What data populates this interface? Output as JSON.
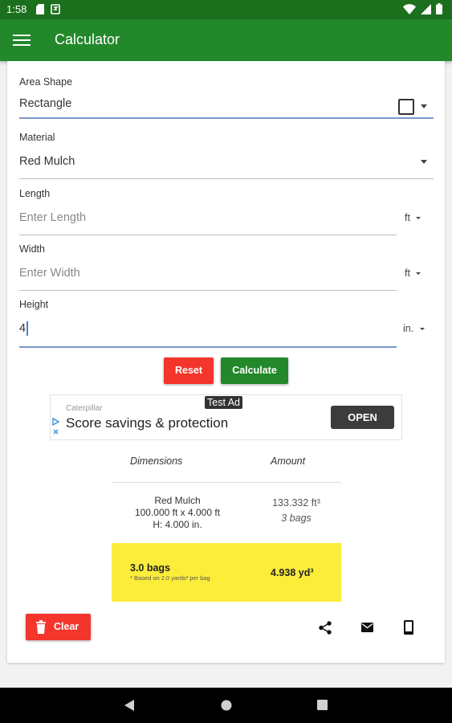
{
  "status_bar": {
    "time": "1:58"
  },
  "app_bar": {
    "title": "Calculator"
  },
  "form": {
    "area_shape": {
      "label": "Area Shape",
      "value": "Rectangle"
    },
    "material": {
      "label": "Material",
      "value": "Red Mulch"
    },
    "length": {
      "label": "Length",
      "placeholder": "Enter Length",
      "unit": "ft"
    },
    "width": {
      "label": "Width",
      "placeholder": "Enter Width",
      "unit": "ft"
    },
    "height": {
      "label": "Height",
      "value": "4",
      "unit": "in."
    }
  },
  "buttons": {
    "reset": "Reset",
    "calculate": "Calculate",
    "clear": "Clear"
  },
  "ad": {
    "tag": "Test Ad",
    "brand": "Caterpillar",
    "title": "Score savings & protection",
    "cta": "OPEN"
  },
  "results": {
    "headers": {
      "dimensions": "Dimensions",
      "amount": "Amount"
    },
    "row": {
      "material": "Red Mulch",
      "dims": "100.000 ft x 4.000 ft",
      "height": "H: 4.000 in.",
      "volume": "133.332 ft³",
      "bags": "3 bags"
    },
    "summary": {
      "bags": "3.0 bags",
      "note": "* Based on 2.0 yards³ per bag",
      "volume": "4.938 yd³"
    }
  },
  "icons": [
    "menu-icon",
    "share-icon",
    "email-icon",
    "phone-icon",
    "trash-icon"
  ],
  "colors": {
    "app_bar": "#23882a",
    "status_bar": "#1b6f1d",
    "reset": "#f4352c",
    "calculate": "#23882a",
    "highlight": "#fbed3a"
  }
}
